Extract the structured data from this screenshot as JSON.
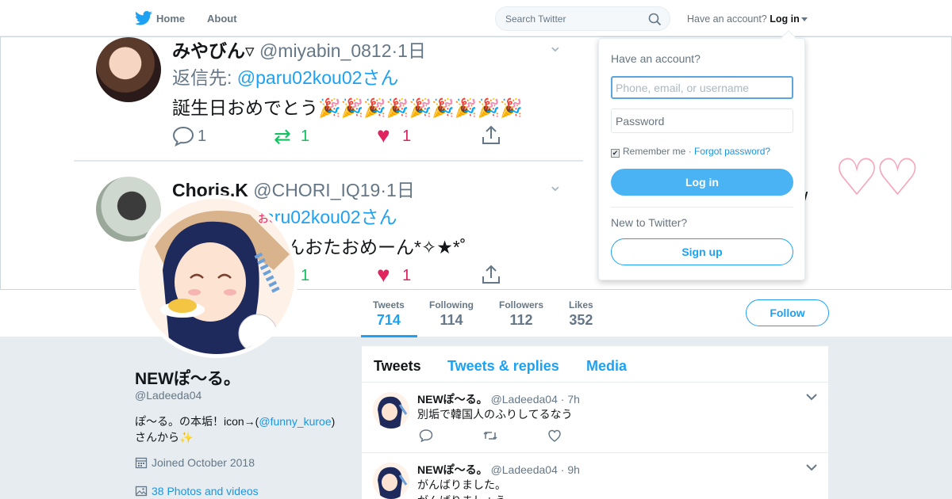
{
  "nav": {
    "home_label": "Home",
    "about_label": "About",
    "search_placeholder": "Search Twitter",
    "have_account": "Have an account?",
    "login_label": "Log in"
  },
  "banner": {
    "tweets": [
      {
        "name": "みやびん",
        "name_suffix": "▿",
        "handle": "@miyabin_0812",
        "time": "1日",
        "reply_label": "返信先:",
        "reply_to": "@paru02kou02さん",
        "text": "誕生日おめでとう🎉🎉🎉🎉🎉🎉🎉🎉🎉",
        "replies": "1",
        "retweets": "1",
        "likes": "1"
      },
      {
        "name": "Choris.K",
        "handle": "@CHORI_IQ19",
        "time": "1日",
        "reply_to": "aru02kou02さん",
        "text": "んおたおめーん*✧★*˚",
        "retweets": "1",
        "likes": "1"
      }
    ]
  },
  "login": {
    "heading": "Have an account?",
    "username_placeholder": "Phone, email, or username",
    "password_placeholder": "Password",
    "remember_label": "Remember me",
    "separator": "·",
    "forgot_label": "Forgot password?",
    "login_button": "Log in",
    "new_label": "New to Twitter?",
    "signup_button": "Sign up"
  },
  "stats": [
    {
      "label": "Tweets",
      "value": "714"
    },
    {
      "label": "Following",
      "value": "114"
    },
    {
      "label": "Followers",
      "value": "112"
    },
    {
      "label": "Likes",
      "value": "352"
    }
  ],
  "follow_label": "Follow",
  "profile": {
    "name": "NEWぽ〜る。",
    "handle": "@Ladeeda04",
    "bio_prefix": "ぽ〜る。の本垢！icon→(",
    "bio_link": "@funny_kuroe",
    "bio_suffix": ")",
    "bio_line2": "さんから✨",
    "joined": "Joined October 2018",
    "photos": "38 Photos and videos"
  },
  "timeline": {
    "tabs": [
      "Tweets",
      "Tweets & replies",
      "Media"
    ],
    "tweets": [
      {
        "name": "NEWぽ〜る。",
        "handle": "@Ladeeda04",
        "sep": "·",
        "time": "7h",
        "text": "別垢で韓国人のふりしてるなう"
      },
      {
        "name": "NEWぽ〜る。",
        "handle": "@Ladeeda04",
        "sep": "·",
        "time": "9h",
        "text": "がんばりました。",
        "text2": "がんばりましょう"
      }
    ]
  },
  "colors": {
    "accent": "#1da1f2",
    "like": "#e0245e",
    "retweet": "#17bf63"
  }
}
